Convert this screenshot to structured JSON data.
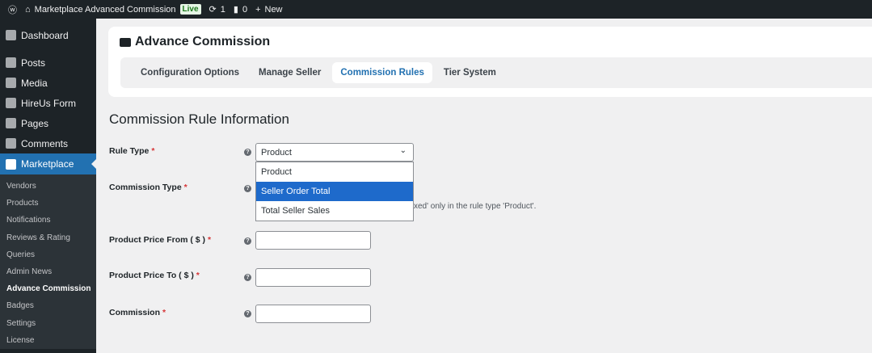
{
  "adminbar": {
    "site": "Marketplace Advanced Commission",
    "live": "Live",
    "updates": "1",
    "comments": "0",
    "new": "New"
  },
  "menu": {
    "top": [
      "Dashboard",
      "Posts",
      "Media",
      "HireUs Form",
      "Pages",
      "Comments"
    ],
    "active": "Marketplace",
    "sub": [
      "Vendors",
      "Products",
      "Notifications",
      "Reviews & Rating",
      "Queries",
      "Admin News",
      "Advance Commission",
      "Badges",
      "Settings",
      "License"
    ]
  },
  "page": {
    "title": "Advance Commission",
    "tabs": [
      "Configuration Options",
      "Manage Seller",
      "Commission Rules",
      "Tier System"
    ]
  },
  "form": {
    "heading": "Commission Rule Information",
    "rule_type": "Rule Type",
    "selected": "Product",
    "options": [
      "Product",
      "Seller Order Total",
      "Total Seller Sales"
    ],
    "commission_type": "Commission Type",
    "note": "xed' only in the rule type 'Product'.",
    "price_from": "Product Price From ( $ )",
    "price_to": "Product Price To ( $ )",
    "commission": "Commission",
    "req": "*",
    "help": "?"
  }
}
